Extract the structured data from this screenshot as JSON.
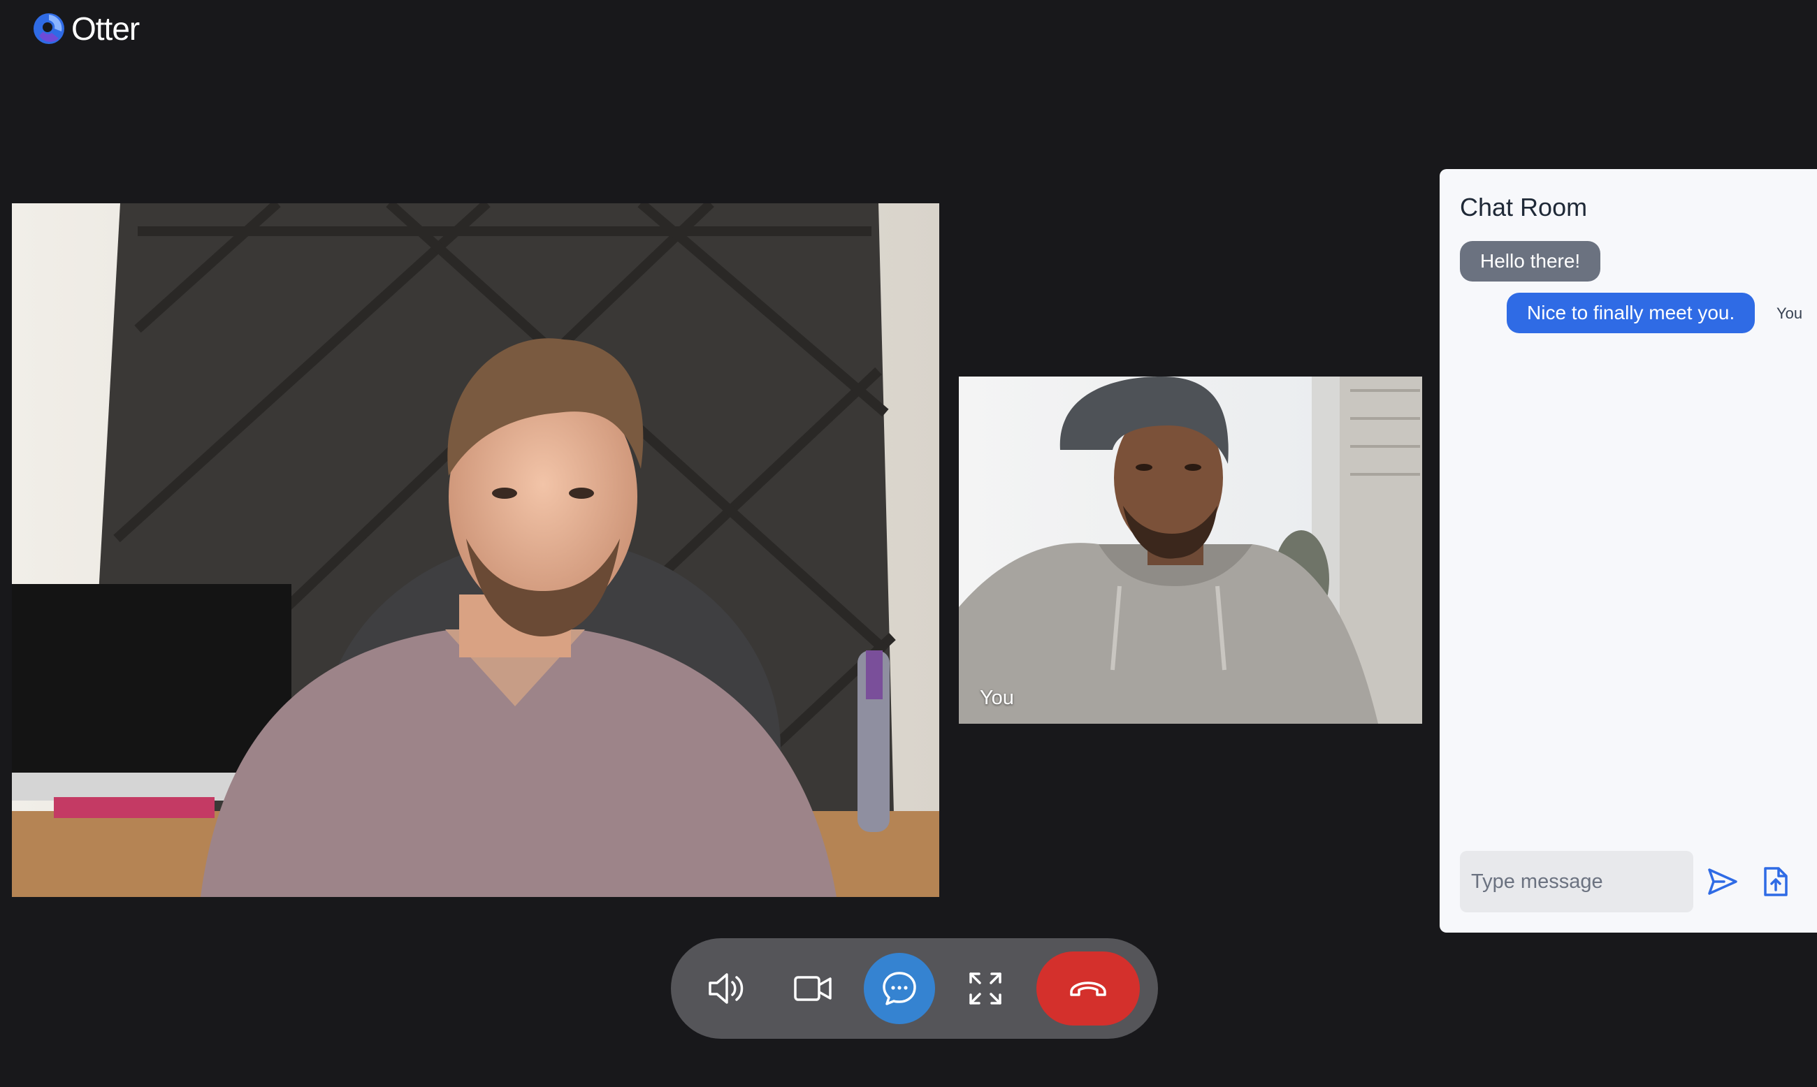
{
  "app": {
    "name": "Otter"
  },
  "videos": {
    "remote": {
      "label": ""
    },
    "self": {
      "label": "You"
    }
  },
  "chat": {
    "title": "Chat Room",
    "messages": [
      {
        "text": "Hello there!",
        "direction": "incoming",
        "sender": ""
      },
      {
        "text": "Nice to finally meet you.",
        "direction": "outgoing",
        "sender": "You"
      }
    ],
    "input": {
      "value": "",
      "placeholder": "Type message"
    }
  },
  "controls": {
    "items": [
      {
        "name": "speaker",
        "icon": "speaker-icon"
      },
      {
        "name": "camera",
        "icon": "video-camera-icon"
      },
      {
        "name": "chat",
        "icon": "chat-bubble-icon",
        "active": true
      },
      {
        "name": "fullscreen",
        "icon": "expand-icon"
      },
      {
        "name": "hang-up",
        "icon": "phone-hangup-icon"
      }
    ]
  },
  "colors": {
    "background": "#18181b",
    "accent": "#2f6be5",
    "chat_active": "#3583d1",
    "hangup": "#d4302c",
    "control_bar": "#555559"
  }
}
